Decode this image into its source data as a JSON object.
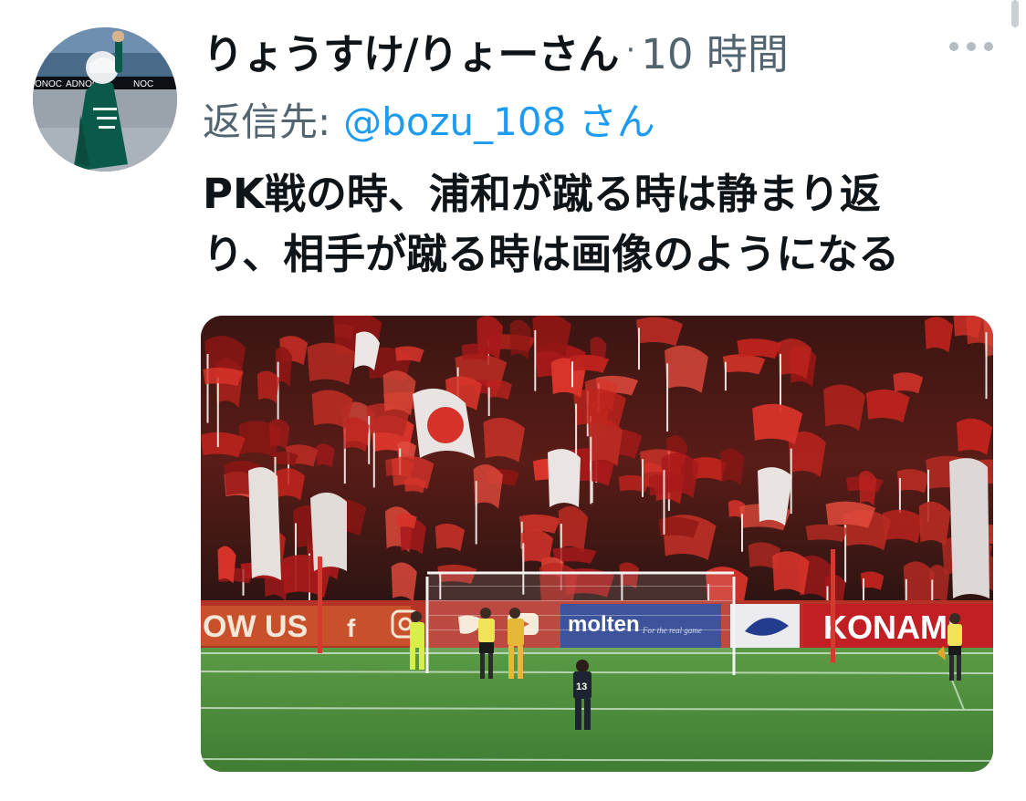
{
  "tweet": {
    "display_name": "りょうすけ/りょーさん",
    "separator": "·",
    "timestamp": "10 時間",
    "reply_label": "返信先:",
    "reply_handle": "@bozu_108 さん",
    "text_line1": "PK戦の時、浦和が蹴る時は静まり返",
    "text_line2": "り、相手が蹴る時は画像のようになる"
  },
  "media": {
    "banner_left": "OW US",
    "social_f": "f",
    "sponsor1": "molten",
    "sponsor1_tag": "For the real game",
    "sponsor2": "KONAMI",
    "player_number": "13"
  },
  "avatar": {
    "board_left": "ONOC",
    "board_mid": "ADNOC",
    "board_right": "NOC"
  },
  "icons": {
    "more": "more-horizontal-icon"
  },
  "colors": {
    "text": "#0f1419",
    "secondary": "#536471",
    "link": "#1d9bf0"
  }
}
